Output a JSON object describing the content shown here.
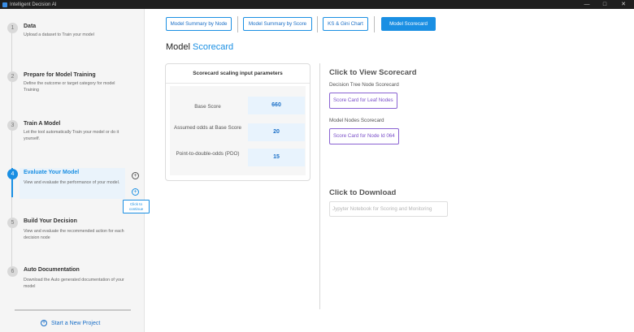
{
  "window": {
    "title": "Intelligent Decision AI",
    "controls": [
      "—",
      "□",
      "✕"
    ]
  },
  "sidebar": {
    "steps": [
      {
        "number": "1",
        "title": "Data",
        "desc": "Upload a dataset to Train your model"
      },
      {
        "number": "2",
        "title": "Prepare for Model Training",
        "desc": "Define the outcome or target category for model Training"
      },
      {
        "number": "3",
        "title": "Train A Model",
        "desc": "Let the tool automatically Train your model or do it yourself."
      },
      {
        "number": "4",
        "title": "Evaluate Your Model",
        "desc": "View and evaluate the performance of your model."
      },
      {
        "number": "5",
        "title": "Build Your Decision",
        "desc": "View and evaluate the recommended action for each decision node"
      },
      {
        "number": "6",
        "title": "Auto Documentation",
        "desc": "Download the Auto generated documentation of your model"
      }
    ],
    "active_step": 4,
    "tooltip": "Click to continue",
    "new_project": "Start a New Project"
  },
  "tabs": [
    {
      "label": "Model Summary by Node"
    },
    {
      "label": "Model Summary by Score"
    },
    {
      "label": "KS & Gini Chart"
    },
    {
      "label": "Model Scorecard"
    }
  ],
  "active_tab": "Model Scorecard",
  "page_title": {
    "part1": "Model",
    "part2": "Scorecard"
  },
  "scaling": {
    "header": "Scorecard scaling input parameters",
    "params": [
      {
        "label": "Base Score",
        "value": "660"
      },
      {
        "label": "Assumed odds at Base Score",
        "value": "20"
      },
      {
        "label": "Point-to-double-odds (PDO)",
        "value": "15"
      }
    ]
  },
  "view": {
    "title": "Click to View Scorecard",
    "decision_tree_label": "Decision Tree Node Scorecard",
    "leaf_button": "Score Card for Leaf Nodes",
    "model_nodes_label": "Model Nodes Scorecard",
    "node_button": "Score Card for Node Id 064"
  },
  "download": {
    "title": "Click to Download",
    "button": "Jypyter Notebook for Scoring and Monitoring"
  },
  "colors": {
    "accent": "#1a8fe3",
    "link_purple": "#7a4fc9",
    "titlebar": "#1f1f1f"
  }
}
